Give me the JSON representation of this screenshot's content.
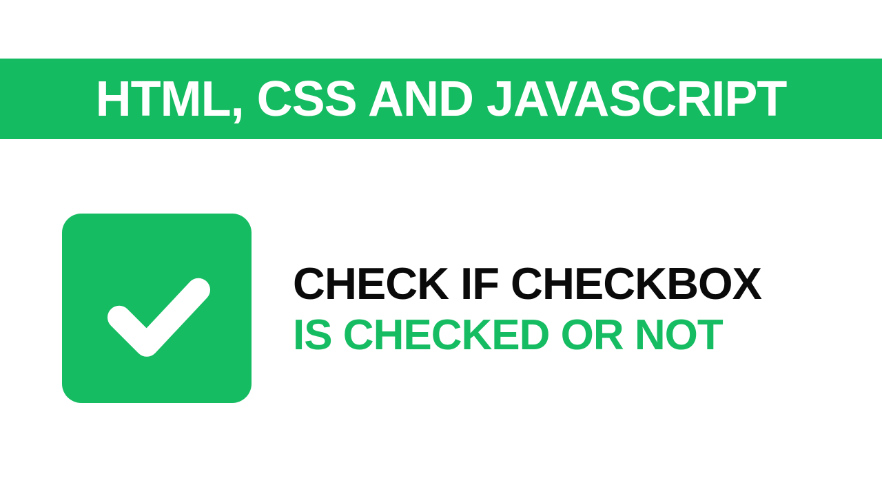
{
  "colors": {
    "green": "#16bc62",
    "white": "#ffffff",
    "black": "#0a0a0a"
  },
  "banner": {
    "text": "HTML, CSS AND JAVASCRIPT"
  },
  "checkbox": {
    "checked": true,
    "icon": "checkmark-icon"
  },
  "title": {
    "line1": "CHECK IF CHECKBOX",
    "line2": "IS CHECKED OR NOT"
  }
}
